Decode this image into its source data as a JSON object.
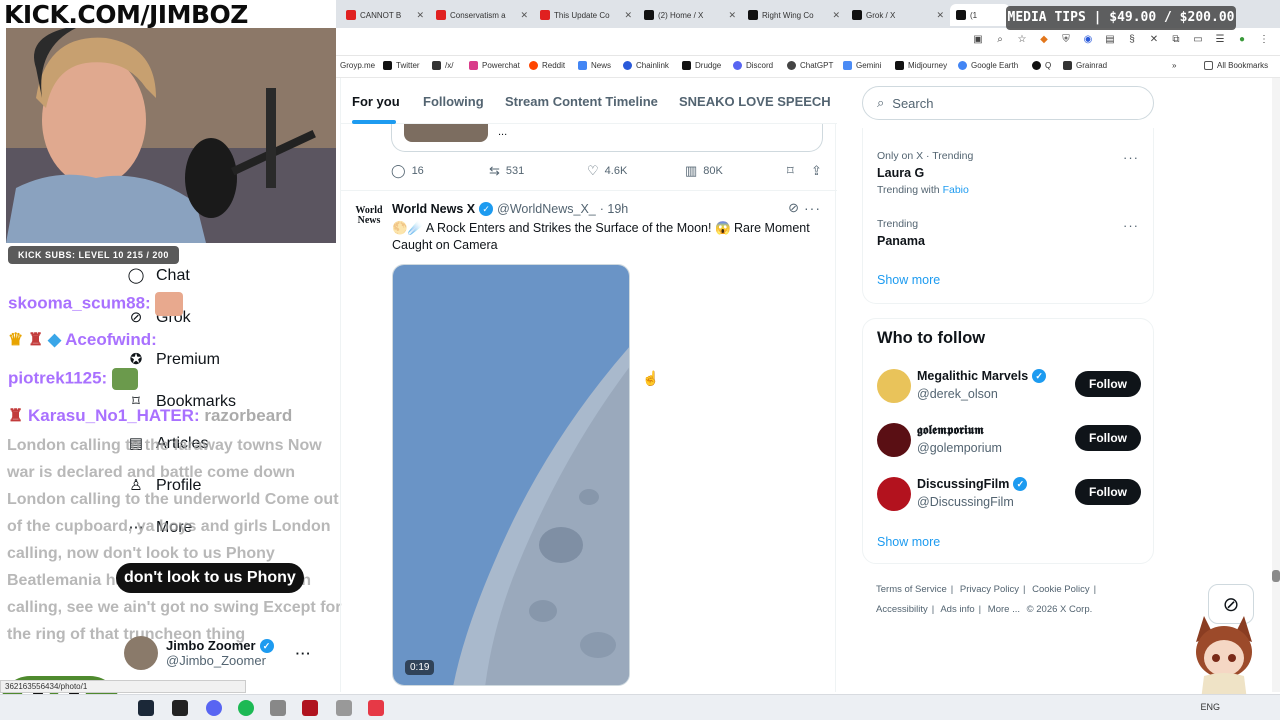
{
  "banner": {
    "text": "KICK.COM/JIMBOZ"
  },
  "kick_subs": "KICK SUBS: LEVEL 10 215 / 200",
  "media_tips": "MEDIA TIPS | $49.00 / $200.00",
  "browser": {
    "tabs": [
      {
        "label": "CANNOT B",
        "color": "#e02020"
      },
      {
        "label": "Conservatism a",
        "color": "#e02020"
      },
      {
        "label": "This Update Co",
        "color": "#e02020"
      },
      {
        "label": "(2) Home / X",
        "color": "#111111"
      },
      {
        "label": "Right Wing Co",
        "color": "#111111"
      },
      {
        "label": "Grok / X",
        "color": "#111111"
      },
      {
        "label": "(1",
        "color": "#111111"
      }
    ],
    "bookmarks": [
      {
        "label": "Groyp.me",
        "color": "#777777"
      },
      {
        "label": "Twitter",
        "color": "#111111"
      },
      {
        "label": "/x/",
        "color": "#333333"
      },
      {
        "label": "Powerchat",
        "color": "#d93c8a"
      },
      {
        "label": "Reddit",
        "color": "#ff4500"
      },
      {
        "label": "News",
        "color": "#4285f4"
      },
      {
        "label": "Chainlink",
        "color": "#2a5ada"
      },
      {
        "label": "Drudge",
        "color": "#111111"
      },
      {
        "label": "Discord",
        "color": "#5865f2"
      },
      {
        "label": "ChatGPT",
        "color": "#444444"
      },
      {
        "label": "Gemini",
        "color": "#4b8bf5"
      },
      {
        "label": "Midjourney",
        "color": "#111111"
      },
      {
        "label": "Google Earth",
        "color": "#4285f4"
      },
      {
        "label": "Q",
        "color": "#111111"
      },
      {
        "label": "Grainrad",
        "color": "#333333"
      }
    ],
    "all_bookmarks": "All Bookmarks"
  },
  "nav": {
    "items": [
      {
        "label": "Chat",
        "icon": "chat-icon"
      },
      {
        "label": "Grok",
        "icon": "grok-icon"
      },
      {
        "label": "Premium",
        "icon": "premium-icon"
      },
      {
        "label": "Bookmarks",
        "icon": "bookmark-icon"
      },
      {
        "label": "Articles",
        "icon": "articles-icon"
      },
      {
        "label": "Profile",
        "icon": "profile-icon"
      },
      {
        "label": "More",
        "icon": "more-icon"
      }
    ],
    "profile": {
      "name": "Jimbo Zoomer",
      "handle": "@Jimbo_Zoomer"
    }
  },
  "chat": {
    "lines": [
      {
        "user": "skooma_scum88:"
      },
      {
        "user": "Aceofwind:"
      },
      {
        "user": "piotrek1125:"
      },
      {
        "user": "Karasu_No1_HATER:",
        "message": "razorbeard"
      }
    ],
    "lyrics": "London calling to the faraway towns Now war is declared and battle come down London calling to the underworld Come out of the cupboard, ya boys and girls London calling, now don't look to us Phony Beatlemania has bitten the dust London calling, see we ain't got no swing Except for the ring of that truncheon thing",
    "caption": "don't look to us Phony"
  },
  "status_url": "362163556434/photo/1",
  "timeline": {
    "tabs": [
      "For you",
      "Following",
      "Stream Content Timeline",
      "SNEAKO LOVE SPEECH"
    ],
    "quote_more": "...",
    "prev_actions": {
      "replies": "16",
      "reposts": "531",
      "likes": "4.6K",
      "views": "80K"
    },
    "tweet": {
      "avatar_text": "World News",
      "name": "World News X",
      "handle": "@WorldNews_X_",
      "time": "· 19h",
      "text": "🌕☄️ A Rock Enters and Strikes the Surface of the Moon! 😱 Rare Moment Caught on Camera",
      "video_duration": "0:19"
    }
  },
  "sidebar": {
    "search_placeholder": "Search",
    "trends": [
      {
        "context": "Only on X · Trending",
        "name": "Laura G",
        "sub_prefix": "Trending with",
        "sub_link": "Fabio"
      },
      {
        "context": "Trending",
        "name": "Panama",
        "sub_prefix": "",
        "sub_link": ""
      }
    ],
    "show_more": "Show more",
    "who_to_follow": {
      "title": "Who to follow",
      "accounts": [
        {
          "name": "Megalithic Marvels",
          "handle": "@derek_olson",
          "verified": true,
          "avatar_color": "#e9c35a"
        },
        {
          "name": "𝖌𝖔𝖑𝖊𝖒𝖕𝖔𝖗𝖎𝖚𝖒",
          "handle": "@golemporium",
          "verified": false,
          "avatar_color": "#5a0f14"
        },
        {
          "name": "DiscussingFilm",
          "handle": "@DiscussingFilm",
          "verified": true,
          "avatar_color": "#b3121e"
        }
      ],
      "follow_label": "Follow",
      "show_more": "Show more"
    },
    "footer": {
      "links": [
        "Terms of Service",
        "Privacy Policy",
        "Cookie Policy",
        "Accessibility",
        "Ads info",
        "More ..."
      ],
      "copyright": "© 2026 X Corp."
    }
  },
  "taskbar": {
    "lang": "ENG"
  }
}
